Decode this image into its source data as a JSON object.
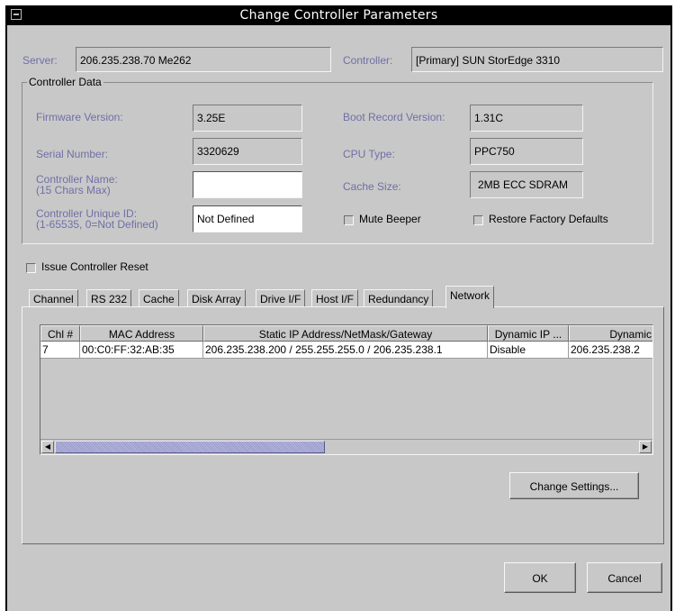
{
  "window": {
    "title": "Change Controller Parameters"
  },
  "server": {
    "label": "Server:",
    "value": "206.235.238.70 Me262"
  },
  "controller": {
    "label": "Controller:",
    "value": "[Primary] SUN StorEdge 3310"
  },
  "controller_data": {
    "group_title": "Controller Data",
    "firmware": {
      "label": "Firmware Version:",
      "value": "3.25E"
    },
    "boot_record": {
      "label": "Boot Record Version:",
      "value": "1.31C"
    },
    "serial": {
      "label": "Serial Number:",
      "value": "3320629"
    },
    "cpu_type": {
      "label": "CPU Type:",
      "value": "PPC750"
    },
    "controller_name": {
      "label_line1": "Controller Name:",
      "label_line2": "(15 Chars Max)",
      "value": ""
    },
    "cache_size": {
      "label": "Cache Size:",
      "value": "2MB ECC SDRAM"
    },
    "unique_id": {
      "label_line1": "Controller Unique ID:",
      "label_line2": "(1-65535,  0=Not Defined)",
      "value": "Not Defined"
    },
    "mute_beeper": {
      "label": "Mute Beeper",
      "checked": false
    },
    "restore_defaults": {
      "label": "Restore Factory Defaults",
      "checked": false
    }
  },
  "issue_reset": {
    "label": "Issue Controller Reset",
    "checked": false
  },
  "tabs": [
    {
      "label": "Channel"
    },
    {
      "label": "RS 232"
    },
    {
      "label": "Cache"
    },
    {
      "label": "Disk Array"
    },
    {
      "label": "Drive I/F"
    },
    {
      "label": "Host I/F"
    },
    {
      "label": "Redundancy"
    },
    {
      "label": "Network",
      "active": true
    }
  ],
  "network_table": {
    "columns": [
      "Chl #",
      "MAC Address",
      "Static IP Address/NetMask/Gateway",
      "Dynamic IP ...",
      "Dynamic"
    ],
    "rows": [
      [
        "7",
        "00:C0:FF:32:AB:35",
        "206.235.238.200 / 255.255.255.0 / 206.235.238.1",
        "Disable",
        "206.235.238.2"
      ]
    ],
    "scroll_position": 0.0
  },
  "buttons": {
    "change_settings": "Change Settings...",
    "ok": "OK",
    "cancel": "Cancel"
  },
  "icons": {
    "window_menu": "window-menu-icon",
    "scroll_left": "arrow-left-icon",
    "scroll_right": "arrow-right-icon"
  },
  "colors": {
    "label_text": "#6f6fa8",
    "background": "#c8c8c8",
    "titlebar": "#000000",
    "scroll_thumb": "#a9a9d8"
  }
}
